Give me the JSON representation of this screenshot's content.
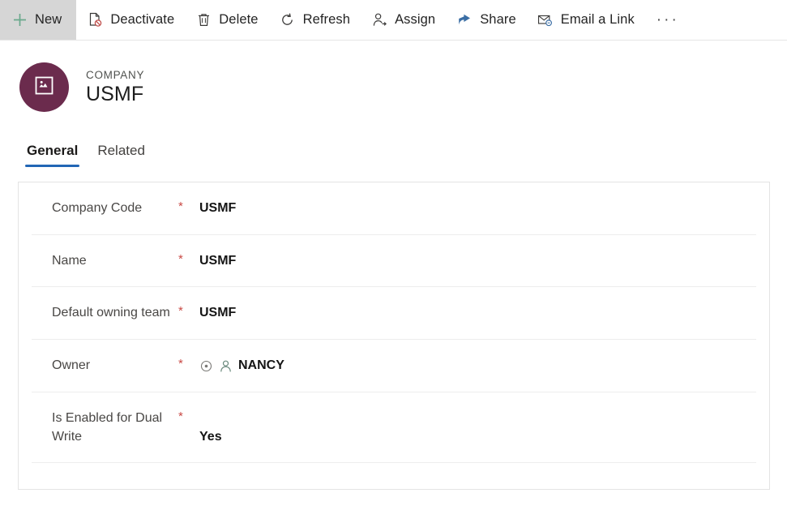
{
  "command_bar": {
    "buttons": [
      {
        "label": "New",
        "icon": "plus-icon",
        "highlighted": true
      },
      {
        "label": "Deactivate",
        "icon": "deactivate-icon",
        "highlighted": false
      },
      {
        "label": "Delete",
        "icon": "trash-icon",
        "highlighted": false
      },
      {
        "label": "Refresh",
        "icon": "refresh-icon",
        "highlighted": false
      },
      {
        "label": "Assign",
        "icon": "assign-user-icon",
        "highlighted": false
      },
      {
        "label": "Share",
        "icon": "share-icon",
        "highlighted": false
      },
      {
        "label": "Email a Link",
        "icon": "email-link-icon",
        "highlighted": false
      }
    ],
    "overflow_label": "···"
  },
  "record_header": {
    "entity_label": "COMPANY",
    "record_name": "USMF",
    "avatar_icon": "company-tile-icon",
    "avatar_color": "#6b2b4d"
  },
  "tabs": [
    {
      "label": "General",
      "active": true
    },
    {
      "label": "Related",
      "active": false
    }
  ],
  "form": {
    "required_marker": "*",
    "rows": [
      {
        "label": "Company Code",
        "required": true,
        "value": "USMF",
        "icons": []
      },
      {
        "label": "Name",
        "required": true,
        "value": "USMF",
        "icons": []
      },
      {
        "label": "Default owning team",
        "required": true,
        "value": "USMF",
        "icons": []
      },
      {
        "label": "Owner",
        "required": true,
        "value": "NANCY",
        "icons": [
          "recent-icon",
          "person-icon"
        ]
      },
      {
        "label": "Is Enabled for Dual Write",
        "required": true,
        "value": "Yes",
        "icons": []
      }
    ]
  },
  "colors": {
    "accent_tab": "#2266b5",
    "required_asterisk": "#c94a46",
    "new_plus": "#6aa98c",
    "share_blue": "#3b6ea5",
    "deactivate_red": "#c0504d"
  }
}
